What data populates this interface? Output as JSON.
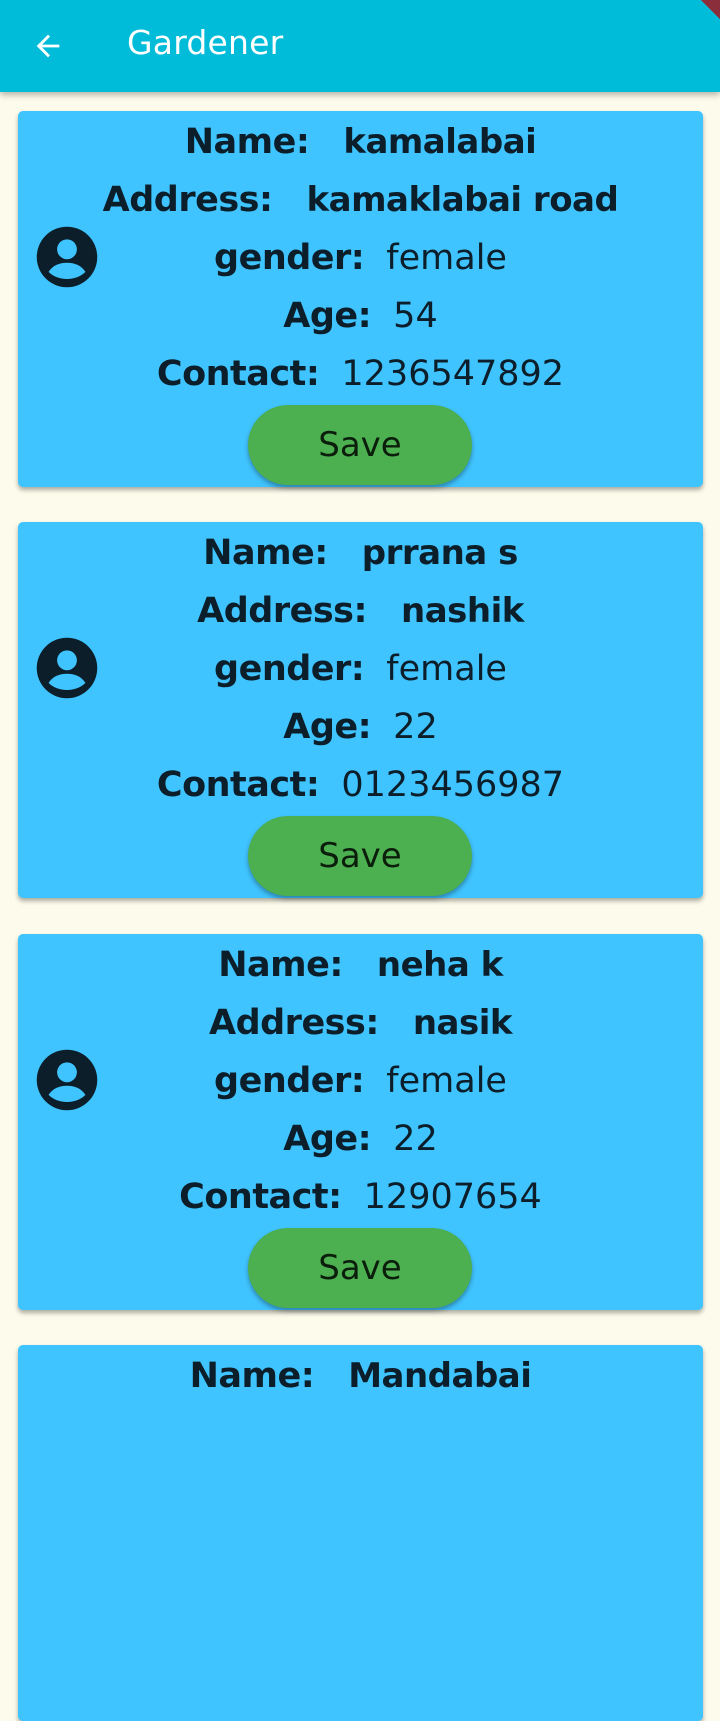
{
  "appbar": {
    "title": "Gardener",
    "back_icon": "arrow-left-icon",
    "background": "#00bcd9"
  },
  "colors": {
    "card": "#40c4ff",
    "save_button": "#4caf50",
    "page_background": "#fdfbeb"
  },
  "labels": {
    "name": "Name:",
    "address": "Address:",
    "gender": "gender:",
    "age": "Age:",
    "contact": "Contact:",
    "save": "Save"
  },
  "gardeners": [
    {
      "name": "kamalabai",
      "address": "kamaklabai road",
      "gender": "female",
      "age": "54",
      "contact": "1236547892"
    },
    {
      "name": "prrana s",
      "address": "nashik",
      "gender": "female",
      "age": "22",
      "contact": "0123456987"
    },
    {
      "name": "neha k",
      "address": "nasik",
      "gender": "female",
      "age": "22",
      "contact": "12907654"
    },
    {
      "name": "Mandabai"
    }
  ]
}
